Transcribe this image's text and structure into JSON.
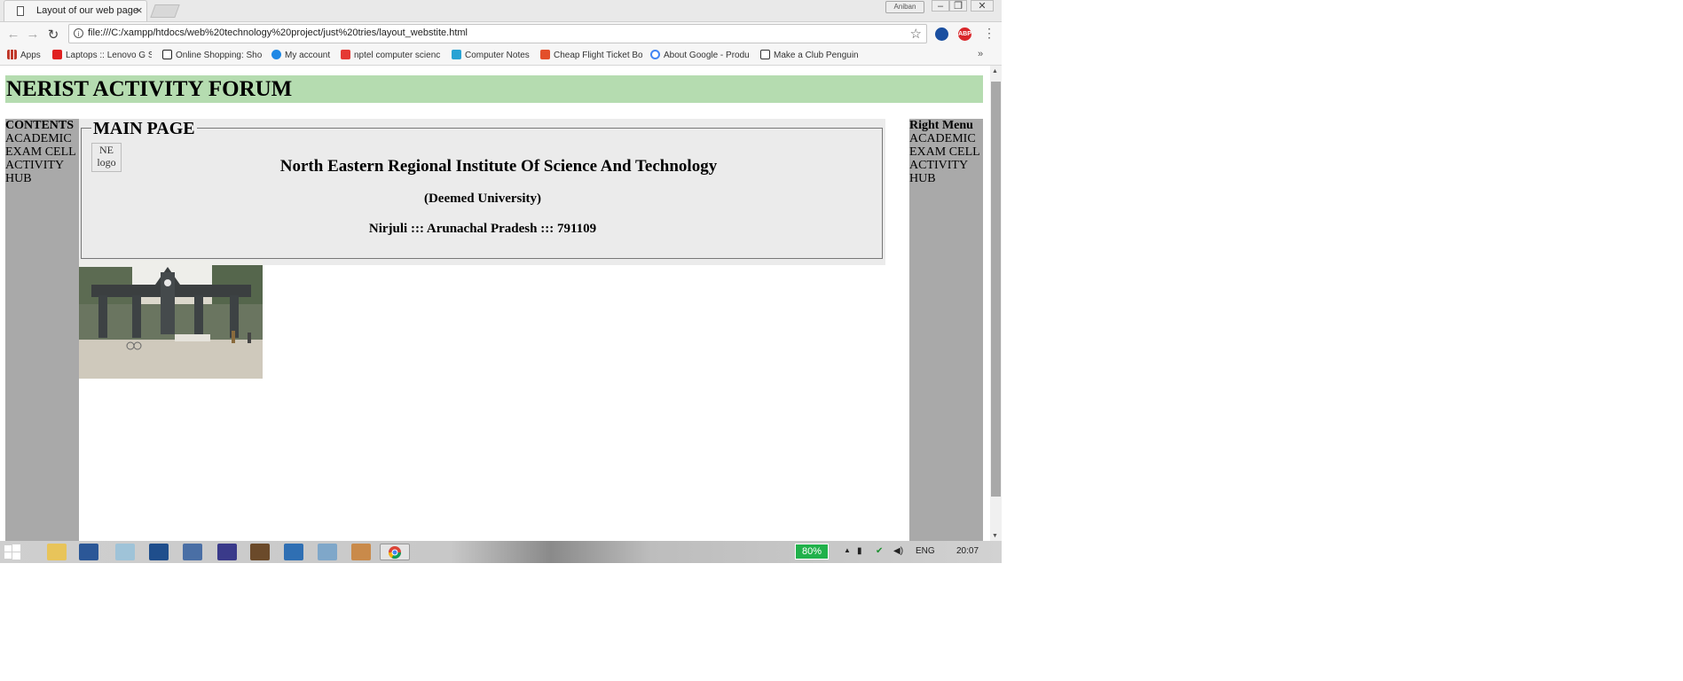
{
  "browser": {
    "tab_title": "Layout of our web page",
    "tab_close": "×",
    "user_name": "Aniban",
    "url": "file:///C:/xampp/htdocs/web%20technology%20project/just%20tries/layout_webstite.html",
    "ext_abp": "ABP",
    "bookmarks": [
      {
        "label": "Apps",
        "icon_color": "#c0392b"
      },
      {
        "label": "Laptops :: Lenovo G S",
        "icon_color": "#e02020"
      },
      {
        "label": "Online Shopping: Sho",
        "icon_color": "#222222"
      },
      {
        "label": "My account",
        "icon_color": "#1e88e5"
      },
      {
        "label": "nptel computer scienc",
        "icon_color": "#e53935"
      },
      {
        "label": "Computer Notes",
        "icon_color": "#29a3d4"
      },
      {
        "label": "Cheap Flight Ticket Bo",
        "icon_color": "#e34f2a"
      },
      {
        "label": "About Google - Produ",
        "icon_color": "#4285f4"
      },
      {
        "label": "Make a Club Penguin",
        "icon_color": "#333333"
      }
    ],
    "bookmarks_more": "»"
  },
  "page": {
    "site_title": "NERIST ACTIVITY FORUM",
    "left_menu": {
      "title": "CONTENTS",
      "items": [
        "ACADEMIC",
        "EXAM CELL",
        "ACTIVITY",
        "HUB"
      ]
    },
    "right_menu": {
      "title": "Right Menu",
      "items": [
        "ACADEMIC",
        "EXAM CELL",
        "ACTIVITY",
        "HUB"
      ]
    },
    "main": {
      "legend": "MAIN PAGE",
      "logo_alt": "NE logo",
      "institute_name": "North Eastern Regional Institute Of Science And Technology",
      "subtitle": "(Deemed University)",
      "address": "Nirjuli ::: Arunachal Pradesh ::: 791109"
    }
  },
  "taskbar": {
    "battery": "80%",
    "language": "ENG",
    "time": "20:07"
  },
  "colors": {
    "header_bg": "#b5dcb0",
    "menu_bg": "#a9a9a9",
    "main_bg": "#ebebeb",
    "battery_green": "#21b14b"
  }
}
